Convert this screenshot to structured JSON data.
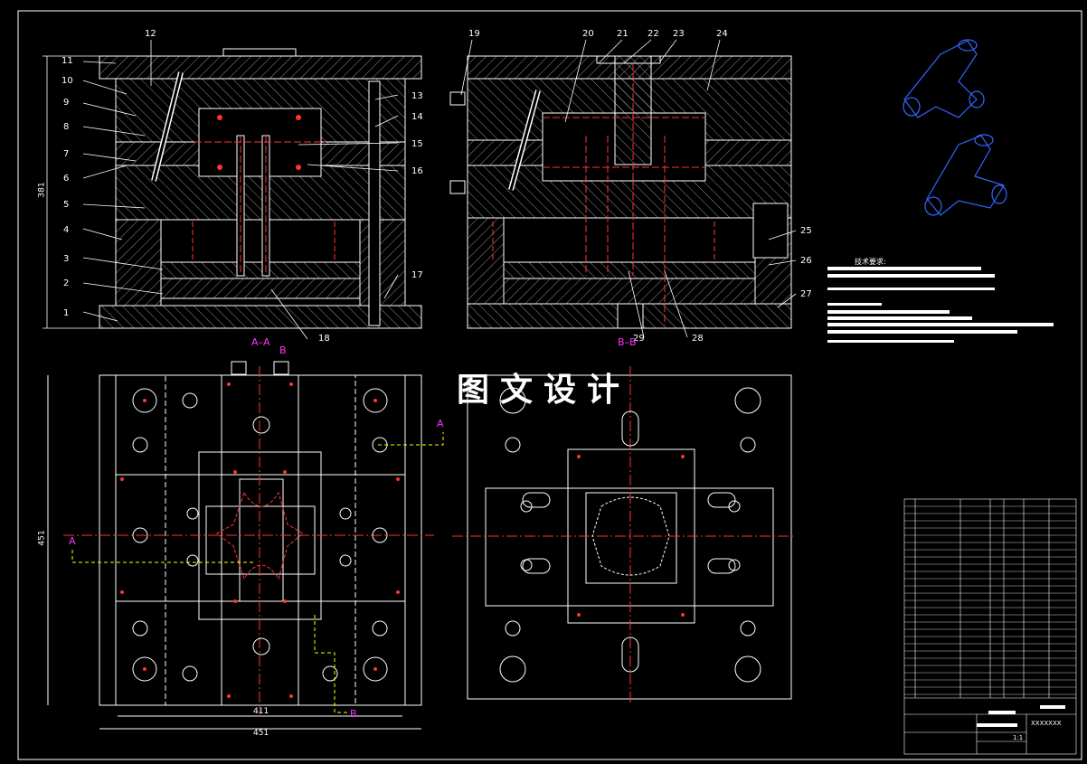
{
  "watermark": "图文设计",
  "section_aa": "A–A",
  "section_bb": "B–B",
  "tech_title": "技术要求:",
  "part_numbers": [
    "1",
    "2",
    "3",
    "4",
    "5",
    "6",
    "7",
    "8",
    "9",
    "10",
    "11",
    "12",
    "13",
    "14",
    "15",
    "16",
    "17",
    "18",
    "19",
    "20",
    "21",
    "22",
    "23",
    "24",
    "25",
    "26",
    "27",
    "28",
    "29"
  ],
  "dimensions": {
    "height": "381",
    "width_plan": "451",
    "inner_width": "411",
    "bottom_width": "451"
  },
  "section_marks": {
    "a": "A",
    "b": "B"
  },
  "title_block": {
    "drawing_no": "XXXXXXX",
    "scale": "1:1"
  },
  "colors": {
    "background": "#000000",
    "line": "#ffffff",
    "hidden": "#ff3333",
    "cut": "#ff33ff",
    "iso": "#3366ff",
    "center": "#ff3333"
  }
}
